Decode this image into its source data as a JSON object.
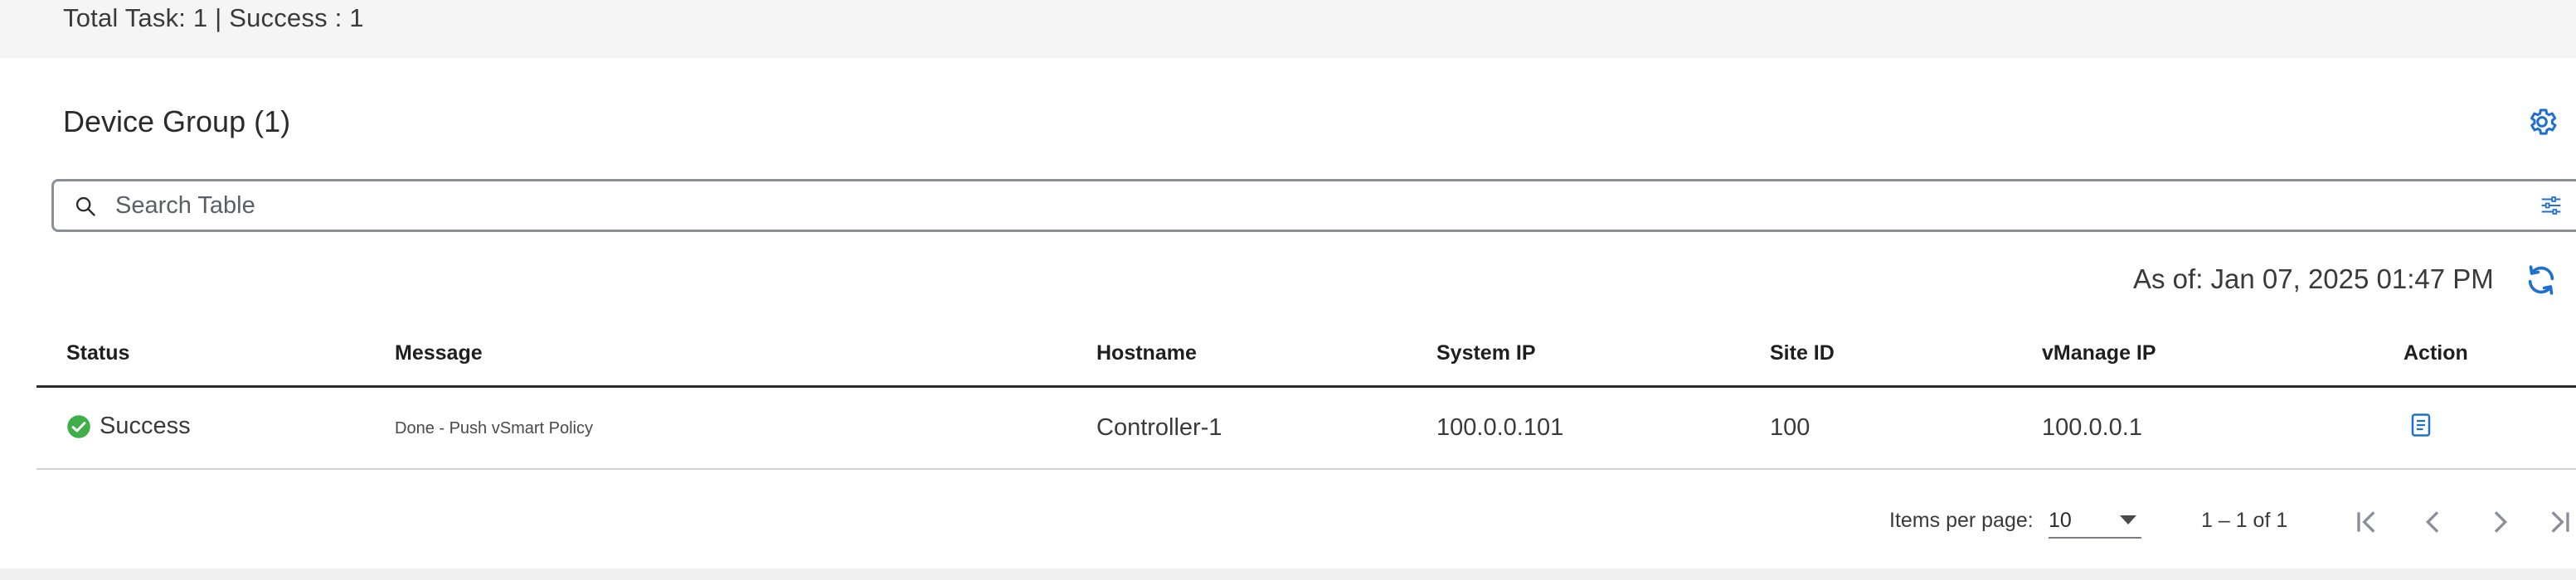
{
  "summary": {
    "text": "Total Task: 1 | Success : 1"
  },
  "device_group": {
    "title": "Device Group (1)",
    "settings_icon": "gear-icon"
  },
  "search": {
    "placeholder": "Search Table",
    "value": "",
    "search_icon": "search-icon",
    "filter_icon": "filter-sliders-icon"
  },
  "timestamp": {
    "text": "As of: Jan 07, 2025 01:47 PM",
    "refresh_icon": "refresh-icon"
  },
  "table": {
    "columns": [
      "Status",
      "Message",
      "Hostname",
      "System IP",
      "Site ID",
      "vManage IP",
      "Action"
    ],
    "rows": [
      {
        "status": "Success",
        "message": "Done - Push vSmart Policy",
        "hostname": "Controller-1",
        "system_ip": "100.0.0.101",
        "site_id": "100",
        "vmanage_ip": "100.0.0.1",
        "action_icon": "document-icon"
      }
    ]
  },
  "pagination": {
    "items_per_page_label": "Items per page:",
    "items_per_page_value": "10",
    "range": "1 – 1 of 1",
    "buttons": [
      "first-page-icon",
      "previous-page-icon",
      "next-page-icon",
      "last-page-icon"
    ]
  },
  "colors": {
    "accent": "#1f6fd1",
    "success": "#3fae49",
    "border": "#8a8f98"
  }
}
